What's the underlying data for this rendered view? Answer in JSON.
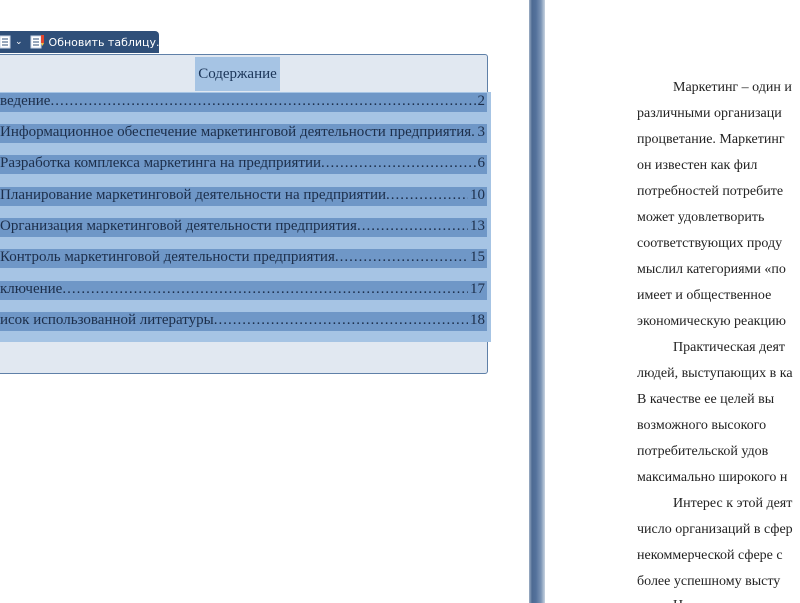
{
  "toolbar": {
    "update_label": "Обновить таблицу..."
  },
  "toc": {
    "title": "Содержание",
    "entries": [
      {
        "text": "ведение",
        "page": "2"
      },
      {
        "text": "Информационное обеспечение маркетинговой деятельности предприятия",
        "page": "3"
      },
      {
        "text": "Разработка комплекса маркетинга на предприятии",
        "page": "6"
      },
      {
        "text": "Планирование маркетинговой деятельности на предприятии",
        "page": "10"
      },
      {
        "text": "Организация маркетинговой деятельности предприятия",
        "page": "13"
      },
      {
        "text": " Контроль маркетинговой деятельности предприятия",
        "page": "15"
      },
      {
        "text": "ключение",
        "page": "17"
      },
      {
        "text": "исок использованной литературы",
        "page": "18"
      }
    ]
  },
  "body_text": {
    "lines": [
      "Маркетинг – один и",
      "различными организаци",
      "процветание. Маркетинг",
      "он известен как фил",
      "потребностей потребите",
      "может удовлетворить",
      "соответствующих проду",
      "мыслил категориями «по",
      "имеет и общественное",
      "экономическую реакцию",
      "Практическая деят",
      "людей, выступающих в ка",
      "В качестве ее целей вы",
      "возможного высокого",
      "потребительской удов",
      "максимально широкого н",
      "Интерес к этой деят",
      "число организаций в сфер",
      "некоммерческой сфере с",
      "более успешному высту",
      "Н"
    ]
  },
  "colors": {
    "toolbar": "#2f4f79",
    "frame": "#e1e8f1",
    "selection": "#a6c4e4",
    "entry_highlight": "#6f97c7"
  }
}
